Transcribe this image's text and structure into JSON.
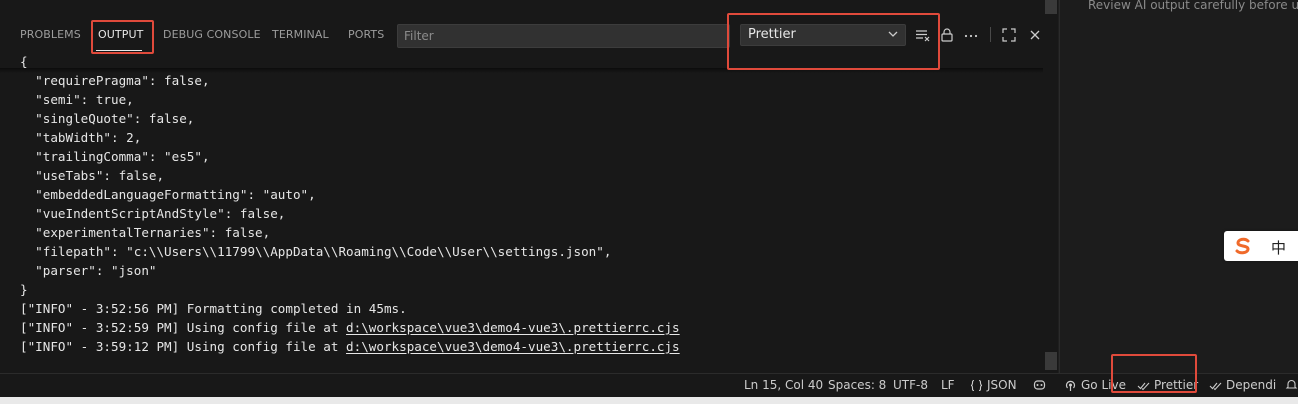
{
  "tabs": [
    {
      "label": "PROBLEMS",
      "active": false
    },
    {
      "label": "OUTPUT",
      "active": true
    },
    {
      "label": "DEBUG CONSOLE",
      "active": false
    },
    {
      "label": "TERMINAL",
      "active": false
    },
    {
      "label": "PORTS",
      "active": false
    }
  ],
  "filter": {
    "placeholder": "Filter",
    "value": ""
  },
  "output_channel": {
    "selected": "Prettier"
  },
  "toolbar": {
    "icons": [
      "clear-output-icon",
      "lock-icon",
      "more-actions-icon",
      "maximize-icon",
      "close-icon"
    ]
  },
  "output_lines": [
    "{",
    "  \"requirePragma\": false,",
    "  \"semi\": true,",
    "  \"singleQuote\": false,",
    "  \"tabWidth\": 2,",
    "  \"trailingComma\": \"es5\",",
    "  \"useTabs\": false,",
    "  \"embeddedLanguageFormatting\": \"auto\",",
    "  \"vueIndentScriptAndStyle\": false,",
    "  \"experimentalTernaries\": false,",
    "  \"filepath\": \"c:\\\\Users\\\\11799\\\\AppData\\\\Roaming\\\\Code\\\\User\\\\settings.json\",",
    "  \"parser\": \"json\"",
    "}",
    "[\"INFO\" - 3:52:56 PM] Formatting completed in 45ms."
  ],
  "log_links": [
    {
      "prefix": "[\"INFO\" - 3:52:59 PM] Using config file at ",
      "link": "d:\\workspace\\vue3\\demo4-vue3\\.prettierrc.cjs"
    },
    {
      "prefix": "[\"INFO\" - 3:59:12 PM] Using config file at ",
      "link": "d:\\workspace\\vue3\\demo4-vue3\\.prettierrc.cjs"
    }
  ],
  "right_panel": {
    "note": "Review AI output carefully before use."
  },
  "ime": {
    "char": "中"
  },
  "statusbar": {
    "position": "Ln 15, Col 40",
    "spaces": "Spaces: 8",
    "encoding": "UTF-8",
    "eol": "LF",
    "language": "JSON",
    "golive": "Go Live",
    "prettier": "Prettier",
    "dependi": "Dependi"
  },
  "colors": {
    "highlight": "#e04a3b",
    "panel_bg": "#181818",
    "text": "#e6e6e6"
  }
}
